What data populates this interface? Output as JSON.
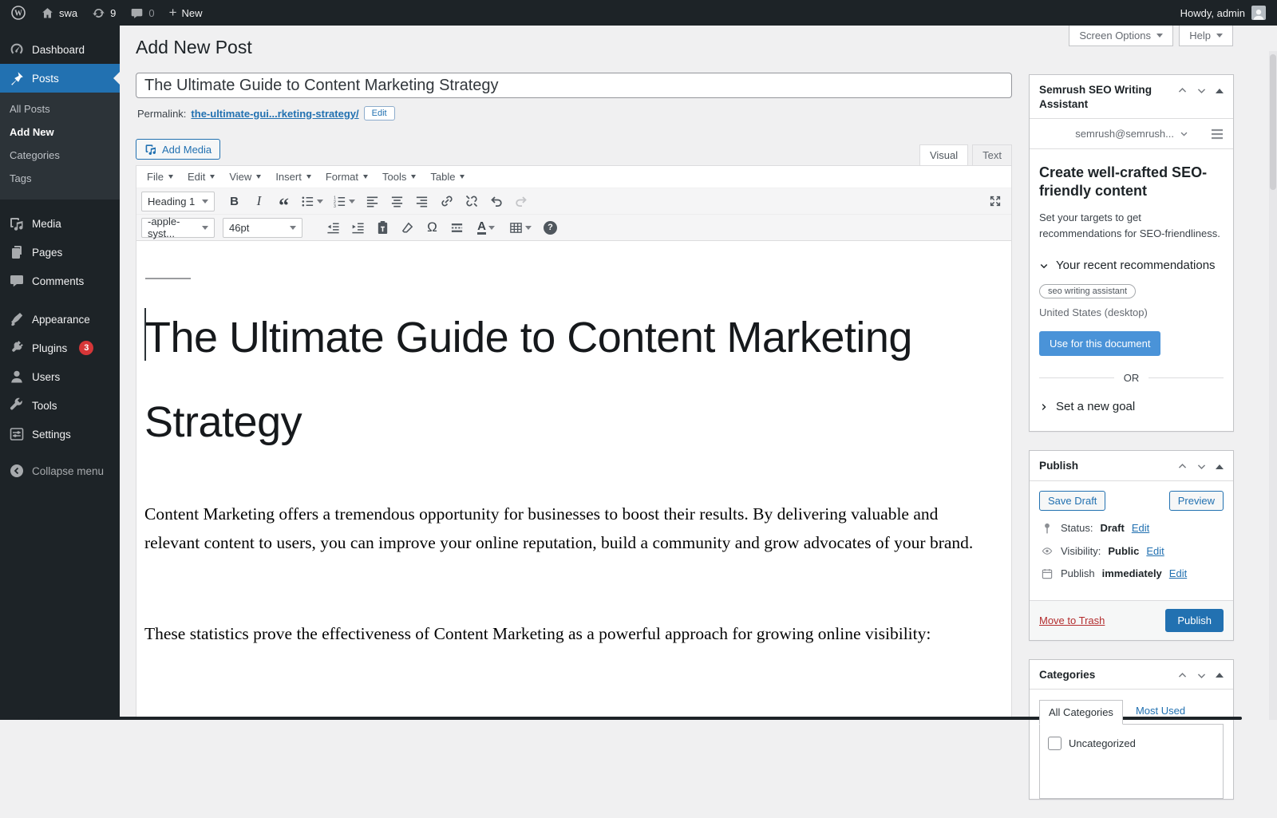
{
  "admin_bar": {
    "site": "swa",
    "updates": "9",
    "comments": "0",
    "new": "New",
    "greeting": "Howdy, admin"
  },
  "top_actions": {
    "screen_options": "Screen Options",
    "help": "Help"
  },
  "sidebar": {
    "dashboard": "Dashboard",
    "posts": "Posts",
    "submenu": [
      "All Posts",
      "Add New",
      "Categories",
      "Tags"
    ],
    "media": "Media",
    "pages": "Pages",
    "comments": "Comments",
    "appearance": "Appearance",
    "plugins": "Plugins",
    "plugins_badge": "3",
    "users": "Users",
    "tools": "Tools",
    "settings": "Settings",
    "collapse": "Collapse menu"
  },
  "page": {
    "title": "Add New Post"
  },
  "post": {
    "title_value": "The Ultimate Guide to Content Marketing Strategy",
    "permalink_label": "Permalink:",
    "permalink_slug": "the-ultimate-gui...rketing-strategy/",
    "edit_button": "Edit",
    "add_media": "Add Media",
    "tab_visual": "Visual",
    "tab_text": "Text"
  },
  "editor": {
    "menubar": [
      "File",
      "Edit",
      "View",
      "Insert",
      "Format",
      "Tools",
      "Table"
    ],
    "format_select": "Heading 1",
    "font_select": "-apple-syst...",
    "size_select": "46pt",
    "heading": "The Ultimate Guide to Content Marketing Strategy",
    "paragraph1": "Content Marketing offers a tremendous opportunity for businesses to boost their results. By delivering valuable and relevant content to users, you can improve your online reputation, build a community and grow advocates of your brand.",
    "paragraph2": "These statistics prove the effectiveness of Content Marketing as a powerful approach for growing online visibility:"
  },
  "semrush": {
    "title": "Semrush SEO Writing Assistant",
    "account": "semrush@semrush...",
    "heading": "Create well-crafted SEO-friendly content",
    "description": "Set your targets to get recommendations for SEO-friendliness.",
    "recommendations": "Your recent recommendations",
    "keyword": "seo writing assistant",
    "locale": "United States (desktop)",
    "use_button": "Use for this document",
    "or": "OR",
    "new_goal": "Set a new goal"
  },
  "publish": {
    "title": "Publish",
    "save_draft": "Save Draft",
    "preview": "Preview",
    "status_label": "Status:",
    "status_value": "Draft",
    "visibility_label": "Visibility:",
    "visibility_value": "Public",
    "schedule_label": "Publish",
    "schedule_value": "immediately",
    "edit": "Edit",
    "move_to_trash": "Move to Trash",
    "publish_button": "Publish"
  },
  "categories": {
    "title": "Categories",
    "tab_all": "All Categories",
    "tab_most_used": "Most Used",
    "item_uncategorized": "Uncategorized"
  },
  "colors": {
    "accent": "#2271b1",
    "semrush_blue": "#4a93d8",
    "badge_red": "#d63638",
    "trash_red": "#b32d2e"
  }
}
